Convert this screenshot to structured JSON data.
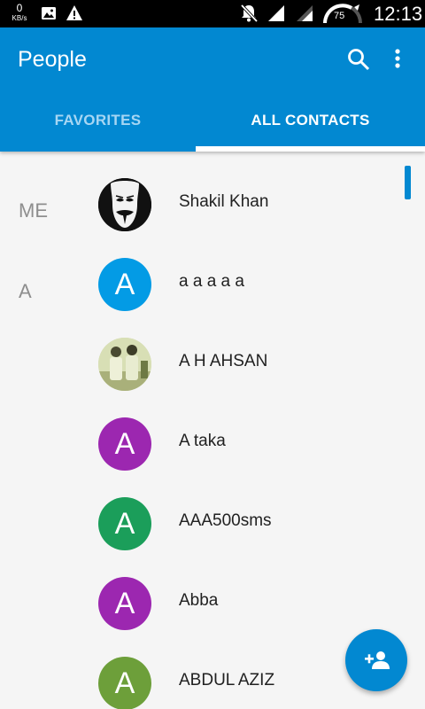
{
  "status_bar": {
    "net_speed_value": "0",
    "net_speed_unit": "KB/s",
    "battery_level": "75",
    "time": "12:13",
    "icons": [
      "image-icon",
      "warning-icon",
      "mute-icon",
      "signal-icon",
      "signal-icon",
      "battery-gauge-icon"
    ]
  },
  "app_bar": {
    "title": "People",
    "icons": [
      "search-icon",
      "more-vert-icon"
    ],
    "tabs": [
      {
        "label": "FAVORITES",
        "selected": false
      },
      {
        "label": "ALL CONTACTS",
        "selected": true
      }
    ],
    "color": "#0288d1"
  },
  "sections": [
    {
      "letter": "ME"
    },
    {
      "letter": "A"
    }
  ],
  "contacts": [
    {
      "name": "Shakil Khan",
      "avatar_type": "photo",
      "avatar_desc": "mask photo"
    },
    {
      "name": "a a a a a",
      "avatar_type": "letter",
      "letter": "A",
      "color": "#039be5"
    },
    {
      "name": "A H AHSAN",
      "avatar_type": "photo",
      "avatar_desc": "group photo"
    },
    {
      "name": "A taka",
      "avatar_type": "letter",
      "letter": "A",
      "color": "#9c27b0"
    },
    {
      "name": "AAA500sms",
      "avatar_type": "letter",
      "letter": "A",
      "color": "#1b9e5a"
    },
    {
      "name": "Abba",
      "avatar_type": "letter",
      "letter": "A",
      "color": "#9c27b0"
    },
    {
      "name": "ABDUL AZIZ",
      "avatar_type": "letter",
      "letter": "A",
      "color": "#6d9f3a"
    }
  ],
  "fab": {
    "icon": "add-person-icon"
  }
}
